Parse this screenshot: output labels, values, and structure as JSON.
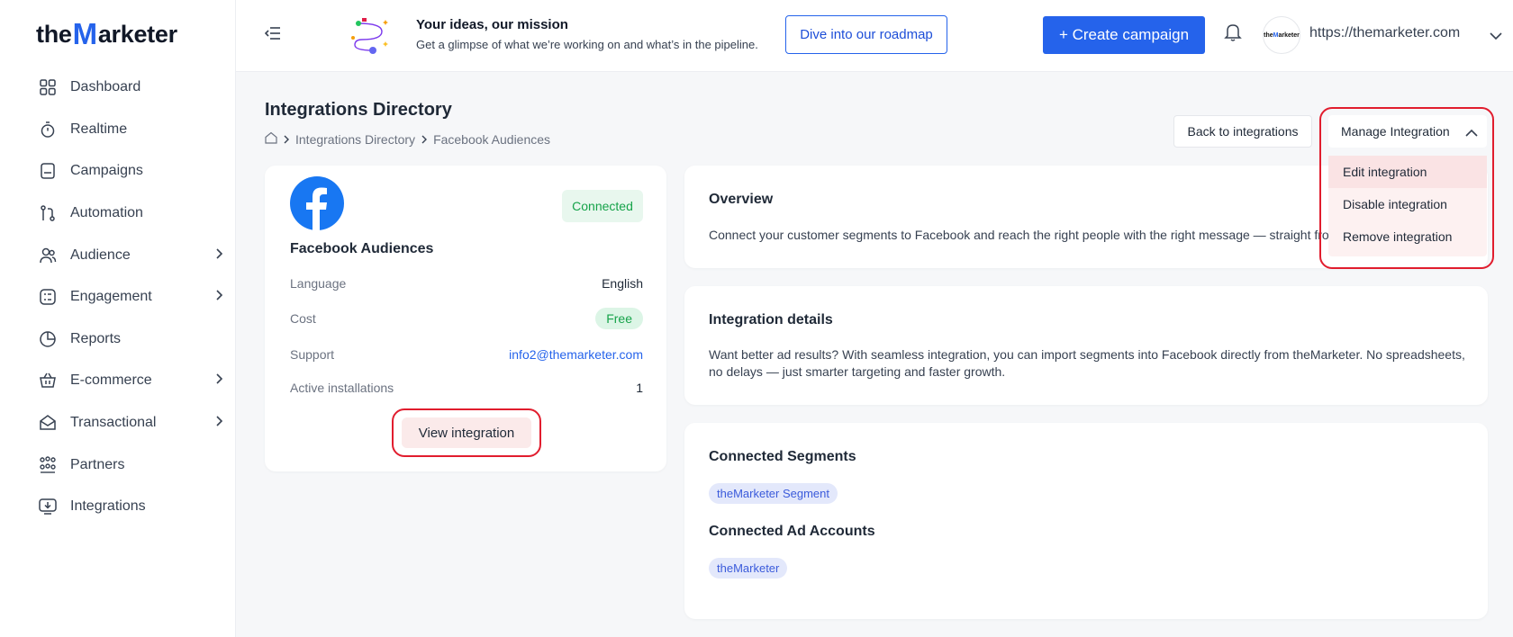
{
  "brand": {
    "pre": "the",
    "m": "M",
    "post": "arketer",
    "avatar_pre": "the",
    "avatar_m": "M",
    "avatar_post": "arketer"
  },
  "sidebar": {
    "items": [
      {
        "label": "Dashboard",
        "icon": "grid-icon",
        "chevron": false
      },
      {
        "label": "Realtime",
        "icon": "stopwatch-icon",
        "chevron": false
      },
      {
        "label": "Campaigns",
        "icon": "campaign-icon",
        "chevron": false
      },
      {
        "label": "Automation",
        "icon": "automation-icon",
        "chevron": false
      },
      {
        "label": "Audience",
        "icon": "audience-icon",
        "chevron": true
      },
      {
        "label": "Engagement",
        "icon": "engagement-icon",
        "chevron": true
      },
      {
        "label": "Reports",
        "icon": "pie-chart-icon",
        "chevron": false
      },
      {
        "label": "E-commerce",
        "icon": "basket-icon",
        "chevron": true
      },
      {
        "label": "Transactional",
        "icon": "envelope-icon",
        "chevron": true
      },
      {
        "label": "Partners",
        "icon": "partners-icon",
        "chevron": false
      },
      {
        "label": "Integrations",
        "icon": "integrations-icon",
        "chevron": false
      }
    ]
  },
  "topbar": {
    "promo_title": "Your ideas, our mission",
    "promo_sub": "Get a glimpse of what we’re working on and what’s in the pipeline.",
    "roadmap_label": "Dive into our roadmap",
    "create_label": "+ Create campaign",
    "account_url": "https://themarketer.com"
  },
  "page": {
    "title": "Integrations Directory",
    "breadcrumb": [
      "Integrations Directory",
      "Facebook Audiences"
    ],
    "back_label": "Back to integrations",
    "manage_label": "Manage Integration",
    "manage_menu": [
      "Edit integration",
      "Disable integration",
      "Remove integration"
    ]
  },
  "integration": {
    "name": "Facebook Audiences",
    "status": "Connected",
    "fields": {
      "language_label": "Language",
      "language": "English",
      "cost_label": "Cost",
      "cost": "Free",
      "support_label": "Support",
      "support": "info2@themarketer.com",
      "installs_label": "Active installations",
      "installs": "1"
    },
    "view_label": "View integration"
  },
  "overview": {
    "title": "Overview",
    "text": "Connect your customer segments to Facebook and reach the right people with the right message — straight from y"
  },
  "details": {
    "title": "Integration details",
    "text": "Want better ad results? With seamless integration, you can import segments into Facebook directly from theMarketer. No spreadsheets, no delays — just smarter targeting and faster growth."
  },
  "connected": {
    "segments_title": "Connected Segments",
    "segments": [
      "theMarketer Segment"
    ],
    "accounts_title": "Connected Ad Accounts",
    "accounts": [
      "theMarketer"
    ]
  },
  "colors": {
    "accent": "#2563eb",
    "highlight": "#e11d2e",
    "success": "#16a34a"
  }
}
